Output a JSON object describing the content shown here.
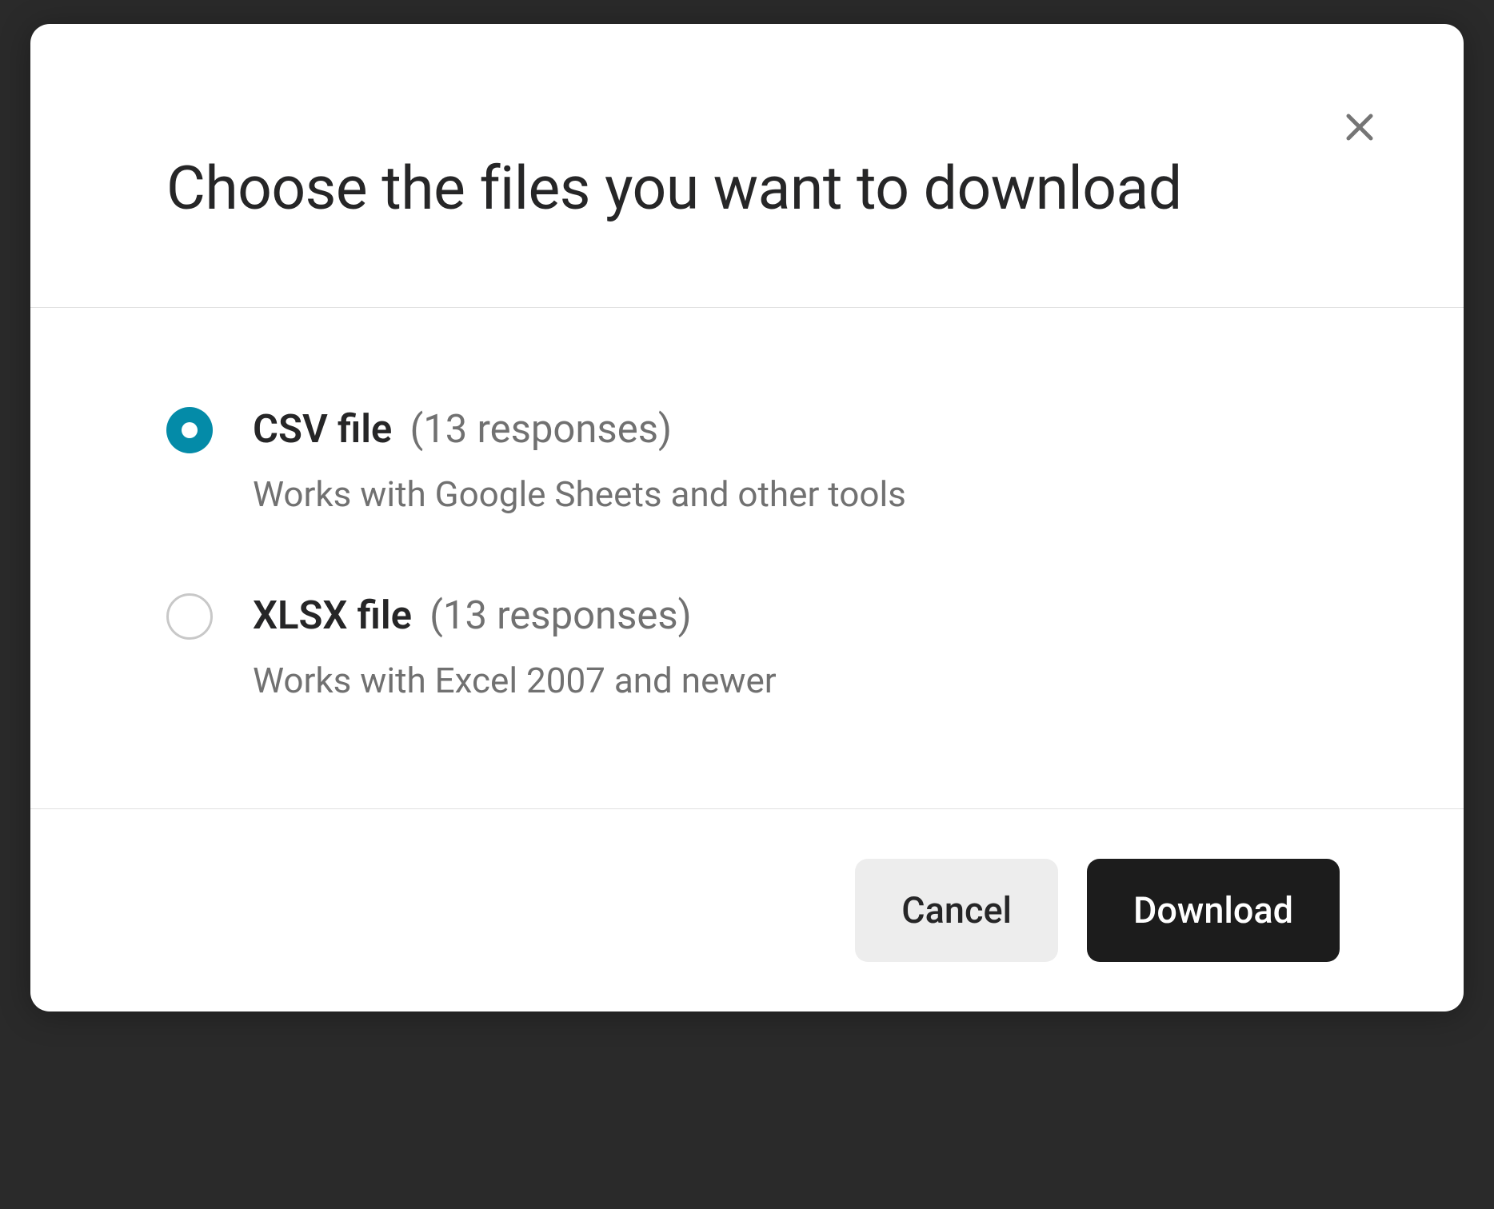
{
  "modal": {
    "title": "Choose the files you want to download",
    "options": [
      {
        "label": "CSV file",
        "meta": "(13 responses)",
        "description": "Works with Google Sheets and other tools",
        "selected": true
      },
      {
        "label": "XLSX file",
        "meta": "(13 responses)",
        "description": "Works with Excel 2007 and newer",
        "selected": false
      }
    ],
    "buttons": {
      "cancel": "Cancel",
      "download": "Download"
    }
  }
}
